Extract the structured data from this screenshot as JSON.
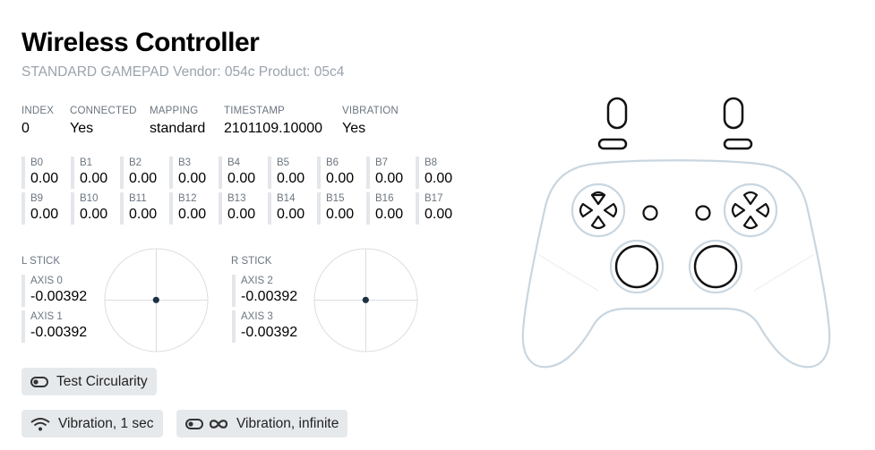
{
  "header": {
    "title": "Wireless Controller",
    "subtitle": "STANDARD GAMEPAD Vendor: 054c Product: 05c4"
  },
  "info": [
    {
      "key": "INDEX",
      "value": "0"
    },
    {
      "key": "CONNECTED",
      "value": "Yes"
    },
    {
      "key": "MAPPING",
      "value": "standard"
    },
    {
      "key": "TIMESTAMP",
      "value": "2101109.10000"
    },
    {
      "key": "VIBRATION",
      "value": "Yes"
    }
  ],
  "buttons": [
    {
      "key": "B0",
      "value": "0.00"
    },
    {
      "key": "B1",
      "value": "0.00"
    },
    {
      "key": "B2",
      "value": "0.00"
    },
    {
      "key": "B3",
      "value": "0.00"
    },
    {
      "key": "B4",
      "value": "0.00"
    },
    {
      "key": "B5",
      "value": "0.00"
    },
    {
      "key": "B6",
      "value": "0.00"
    },
    {
      "key": "B7",
      "value": "0.00"
    },
    {
      "key": "B8",
      "value": "0.00"
    },
    {
      "key": "B9",
      "value": "0.00"
    },
    {
      "key": "B10",
      "value": "0.00"
    },
    {
      "key": "B11",
      "value": "0.00"
    },
    {
      "key": "B12",
      "value": "0.00"
    },
    {
      "key": "B13",
      "value": "0.00"
    },
    {
      "key": "B14",
      "value": "0.00"
    },
    {
      "key": "B15",
      "value": "0.00"
    },
    {
      "key": "B16",
      "value": "0.00"
    },
    {
      "key": "B17",
      "value": "0.00"
    }
  ],
  "sticks": {
    "left": {
      "label": "L STICK",
      "axes": [
        {
          "key": "AXIS 0",
          "value": "-0.00392"
        },
        {
          "key": "AXIS 1",
          "value": "-0.00392"
        }
      ]
    },
    "right": {
      "label": "R STICK",
      "axes": [
        {
          "key": "AXIS 2",
          "value": "-0.00392"
        },
        {
          "key": "AXIS 3",
          "value": "-0.00392"
        }
      ]
    }
  },
  "actions": {
    "test_circularity": "Test Circularity",
    "vibration_1s": "Vibration, 1 sec",
    "vibration_infinite": "Vibration, infinite"
  },
  "colors": {
    "outline": "#c9d6e0",
    "stick_dot": "#1c3144",
    "button_bg": "#e6e9ec"
  }
}
